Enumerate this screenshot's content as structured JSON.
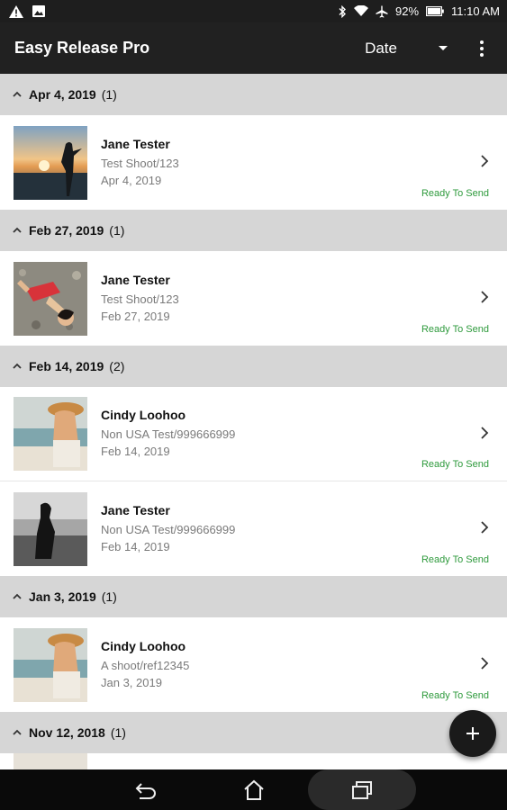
{
  "status_bar": {
    "battery": "92%",
    "time": "11:10 AM"
  },
  "app_bar": {
    "title": "Easy Release Pro",
    "sort_label": "Date"
  },
  "groups": [
    {
      "date": "Apr 4, 2019",
      "count": "(1)",
      "items": [
        {
          "name": "Jane Tester",
          "job": "Test Shoot/123",
          "date": "Apr 4, 2019",
          "status": "Ready To Send"
        }
      ]
    },
    {
      "date": "Feb 27, 2019",
      "count": "(1)",
      "items": [
        {
          "name": "Jane Tester",
          "job": "Test Shoot/123",
          "date": "Feb 27, 2019",
          "status": "Ready To Send"
        }
      ]
    },
    {
      "date": "Feb 14, 2019",
      "count": "(2)",
      "items": [
        {
          "name": "Cindy Loohoo",
          "job": "Non USA Test/999666999",
          "date": "Feb 14, 2019",
          "status": "Ready To Send"
        },
        {
          "name": "Jane Tester",
          "job": "Non USA Test/999666999",
          "date": "Feb 14, 2019",
          "status": "Ready To Send"
        }
      ]
    },
    {
      "date": "Jan 3, 2019",
      "count": "(1)",
      "items": [
        {
          "name": "Cindy Loohoo",
          "job": "A shoot/ref12345",
          "date": "Jan 3, 2019",
          "status": "Ready To Send"
        }
      ]
    },
    {
      "date": "Nov 12, 2018",
      "count": "(1)",
      "items": []
    }
  ],
  "icons": {
    "collapse": "chevron-up-icon",
    "open": "chevron-right-icon",
    "add": "plus-icon"
  },
  "colors": {
    "status_ready": "#2e9a3c",
    "app_bar": "#212121",
    "group_header": "#d6d6d6"
  }
}
